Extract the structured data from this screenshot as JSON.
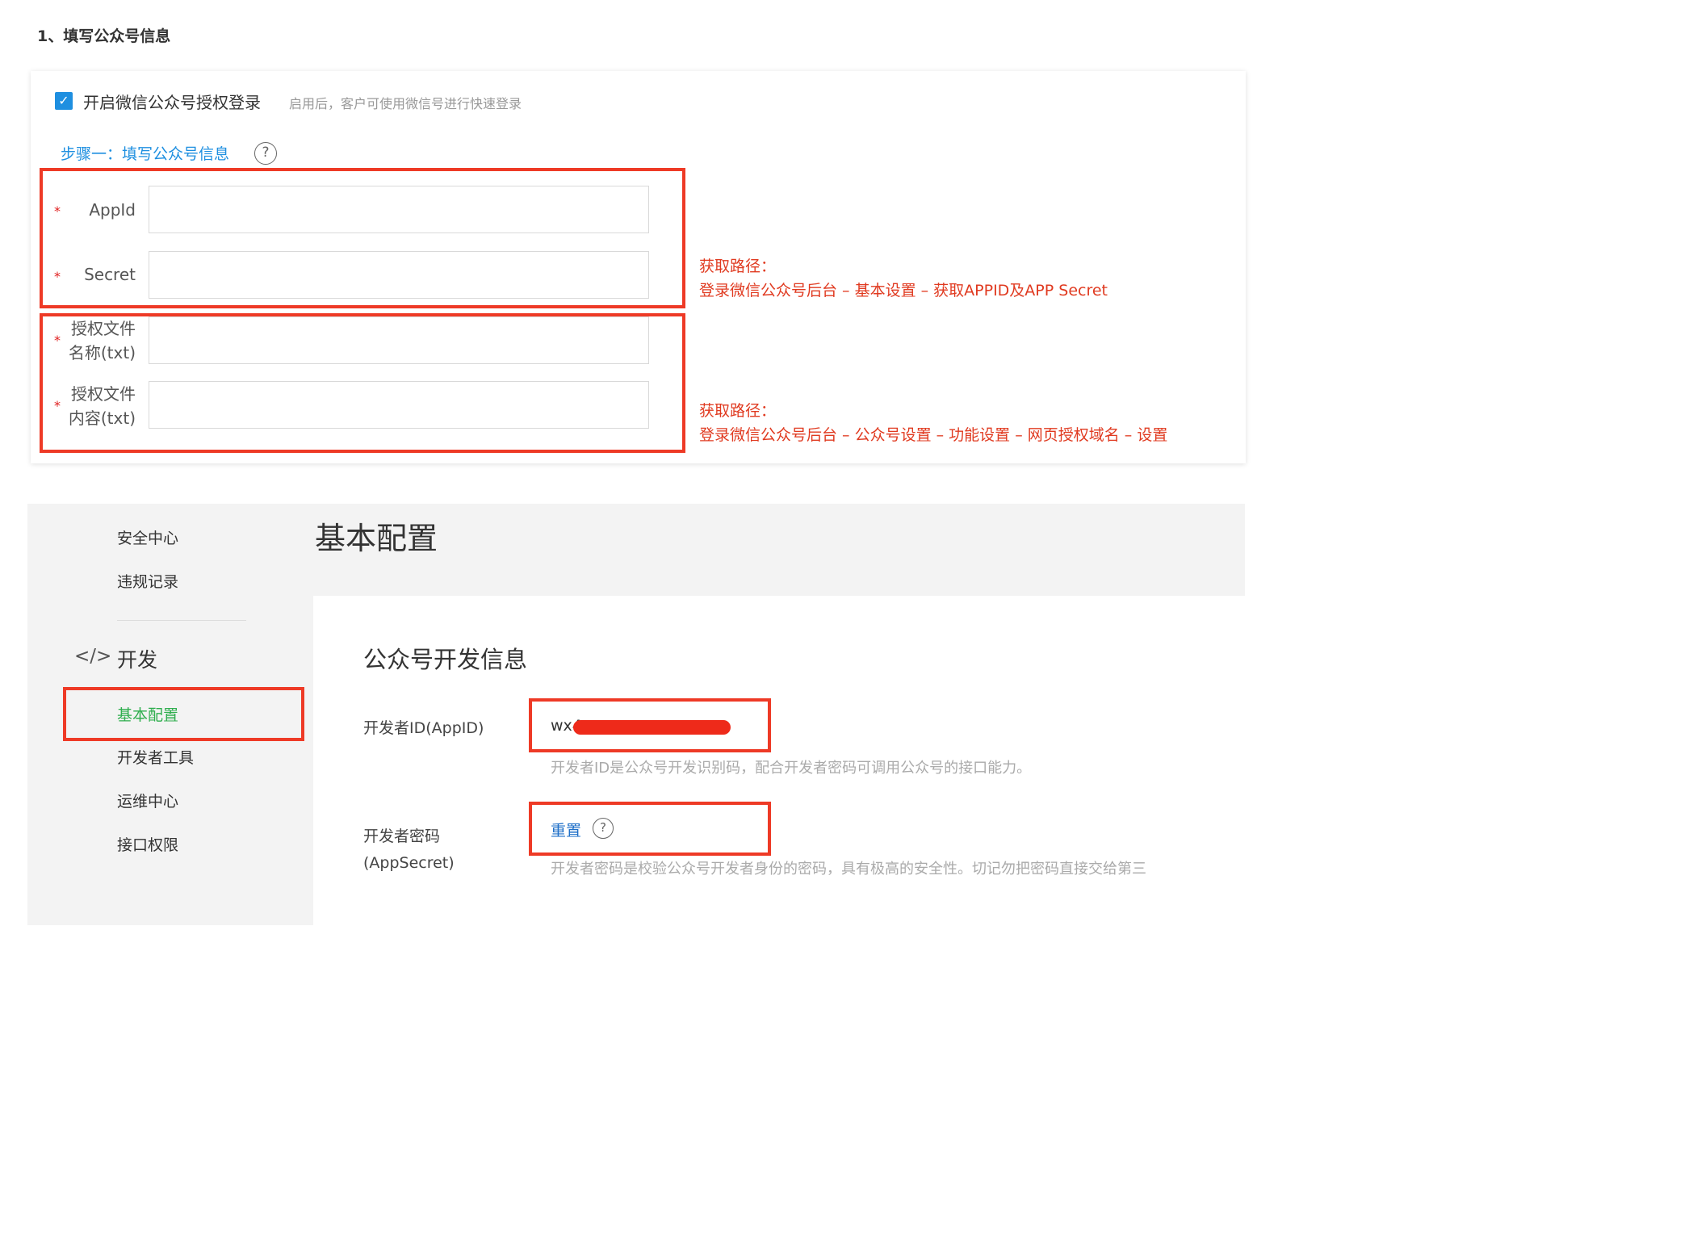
{
  "section_heading": "1、填写公众号信息",
  "form": {
    "enable_checked": true,
    "enable_label": "开启微信公众号授权登录",
    "enable_hint": "启用后，客户可使用微信号进行快速登录",
    "step_title": "步骤一：填写公众号信息",
    "required_mark": "*",
    "fields": [
      {
        "label": "AppId",
        "value": ""
      },
      {
        "label": "Secret",
        "value": ""
      },
      {
        "label_line1": "授权文件",
        "label_line2": "名称(txt)",
        "value": ""
      },
      {
        "label_line1": "授权文件",
        "label_line2": "内容(txt)",
        "value": ""
      }
    ]
  },
  "notes": [
    {
      "line1": "获取路径：",
      "line2": "登录微信公众号后台 – 基本设置 – 获取APPID及APP Secret"
    },
    {
      "line1": "获取路径：",
      "line2": "登录微信公众号后台 – 公众号设置 – 功能设置 – 网页授权域名 – 设置"
    }
  ],
  "wechat_admin": {
    "sidebar": {
      "items_top": [
        "安全中心",
        "违规记录"
      ],
      "group_label": "开发",
      "group_icon": "code-icon",
      "items_dev": [
        "基本配置",
        "开发者工具",
        "运维中心",
        "接口权限"
      ],
      "active_item": "基本配置"
    },
    "page_title": "基本配置",
    "card_title": "公众号开发信息",
    "developer_id": {
      "label": "开发者ID(AppID)",
      "value_prefix": "wx4",
      "hint": "开发者ID是公众号开发识别码，配合开发者密码可调用公众号的接口能力。"
    },
    "developer_secret": {
      "label_line1": "开发者密码",
      "label_line2": "(AppSecret)",
      "action": "重置",
      "hint": "开发者密码是校验公众号开发者身份的密码，具有极高的安全性。切记勿把密码直接交给第三"
    }
  },
  "colors": {
    "accent_blue": "#1e8fe0",
    "annotation_red": "#ee3a26",
    "active_green": "#2fae4e",
    "link_blue": "#1e6fc8"
  }
}
